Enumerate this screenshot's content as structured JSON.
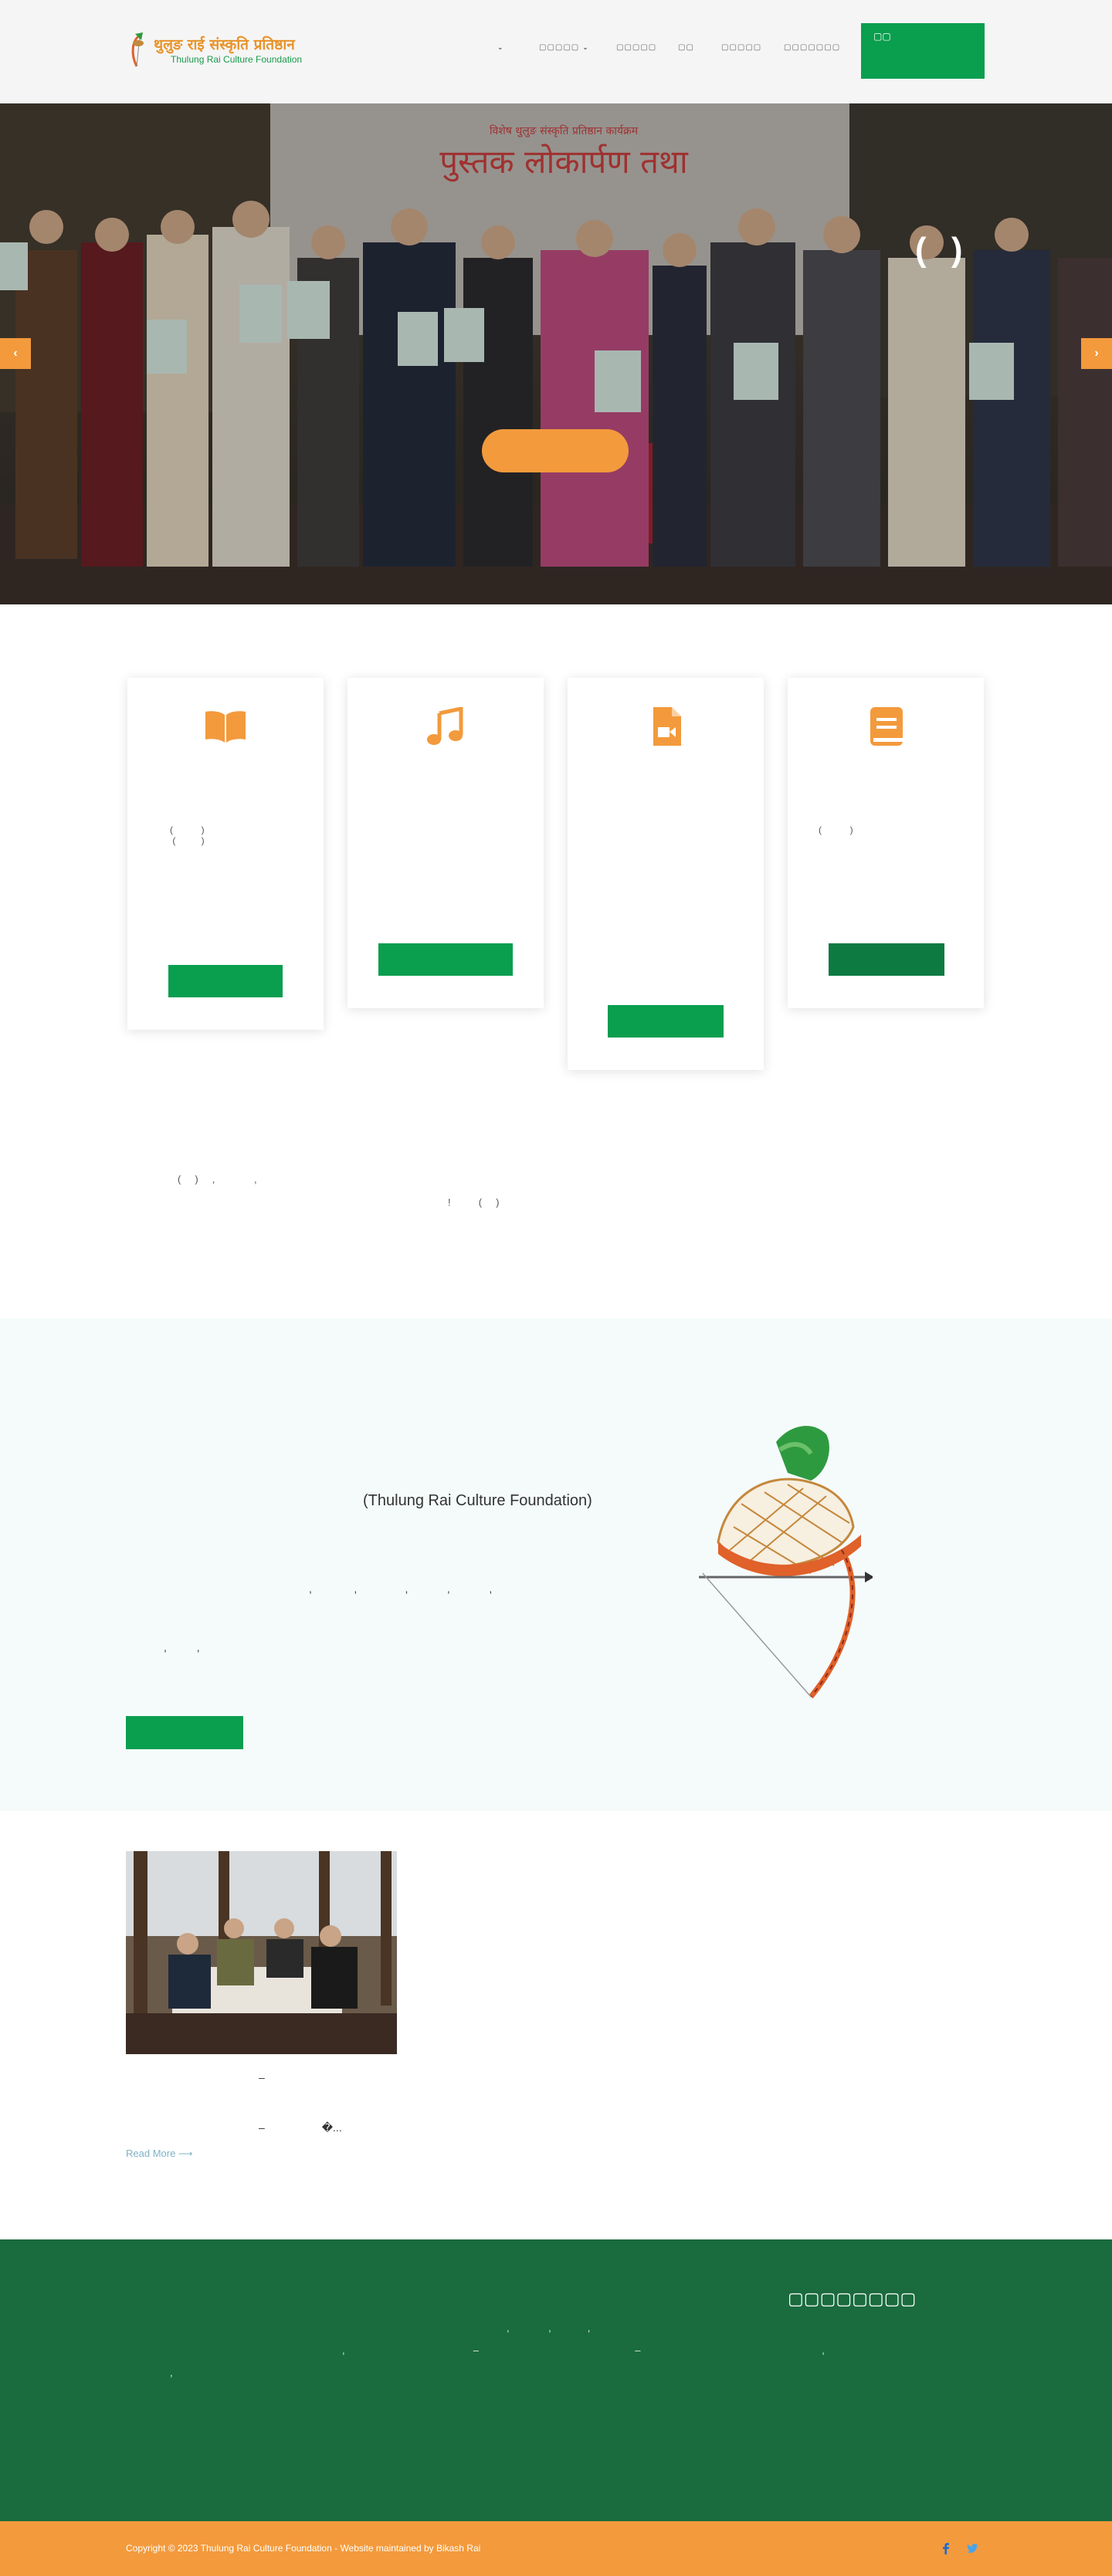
{
  "header": {
    "logo_title": "थुलुङ राई संस्कृति प्रतिष्ठान",
    "logo_subtitle": "Thulung Rai Culture Foundation",
    "nav": [
      {
        "label": "",
        "caret": "⌄"
      },
      {
        "label": "▢▢▢▢▢",
        "caret": "⌄"
      },
      {
        "label": "▢▢▢▢▢",
        "caret": ""
      },
      {
        "label": "▢▢",
        "caret": ""
      },
      {
        "label": "▢▢▢▢▢",
        "caret": ""
      },
      {
        "label": "▢▢▢▢▢▢▢",
        "caret": ""
      }
    ],
    "donate_label": "▢▢"
  },
  "hero": {
    "heading": "( )",
    "cta_label": "",
    "prev_label": "‹",
    "next_label": "›",
    "banner_text": "पुस्तक लोकार्पण तथा",
    "banner_small": "विशेष थुलुङ संस्कृति प्रतिष्ठान कार्यक्रम"
  },
  "cards": [
    {
      "icon": "book-open-icon",
      "text": "(           )\n (          )",
      "button": ""
    },
    {
      "icon": "music-note-icon",
      "text": "",
      "button": ""
    },
    {
      "icon": "video-file-icon",
      "text": "",
      "button": ""
    },
    {
      "icon": "book-icon",
      "text": "(           )",
      "button": ""
    }
  ],
  "intro": {
    "line1": "(     )     ,              ,",
    "line2": "!          (     )"
  },
  "about": {
    "title": "(Thulung Rai Culture Foundation)",
    "line1": ",              ,                ,             ,             ,",
    "line2": ",          ,",
    "button": ""
  },
  "news": {
    "line1": "–",
    "line2": "–                   �...",
    "read_more": "Read More ⟶"
  },
  "footer": {
    "heading": "▢▢▢▢▢▢▢▢",
    "line1": ",              ,             ,",
    "line2": ",                                              –                                                        –                                                                 ,",
    "line3": ","
  },
  "bottom": {
    "copyright": "Copyright © 2023 Thulung Rai Culture Foundation - Website maintained by Bikash Rai",
    "social": [
      "facebook-icon",
      "twitter-icon"
    ]
  },
  "colors": {
    "accent_orange": "#f39a3c",
    "brand_green": "#0a9e4f",
    "footer_green": "#1a6b3e"
  }
}
